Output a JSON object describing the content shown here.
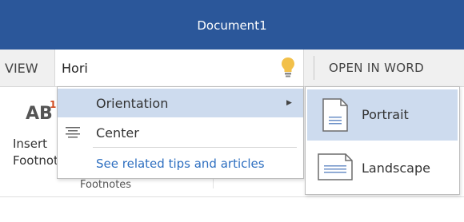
{
  "window": {
    "title": "Document1"
  },
  "toolbar": {
    "view_tab_label": "VIEW",
    "search_value": "Hori",
    "open_in_word_label": "OPEN IN WORD"
  },
  "ribbon": {
    "insert_label_line1": "Insert",
    "insert_label_line2": "Footnote",
    "group_label": "Footnotes"
  },
  "menu": {
    "items": [
      {
        "label": "Orientation",
        "selected": true,
        "has_submenu": true
      },
      {
        "label": "Center",
        "icon": "align-center-icon"
      },
      {
        "label": "See related tips and articles",
        "is_link": true
      }
    ]
  },
  "submenu": {
    "items": [
      {
        "label": "Portrait",
        "selected": true,
        "icon": "portrait-page-icon"
      },
      {
        "label": "Landscape",
        "icon": "landscape-page-icon"
      }
    ]
  },
  "colors": {
    "titlebar": "#2b579a",
    "selection": "#cddbee",
    "link": "#2e6fc0",
    "bulb": "#f2c04a"
  }
}
